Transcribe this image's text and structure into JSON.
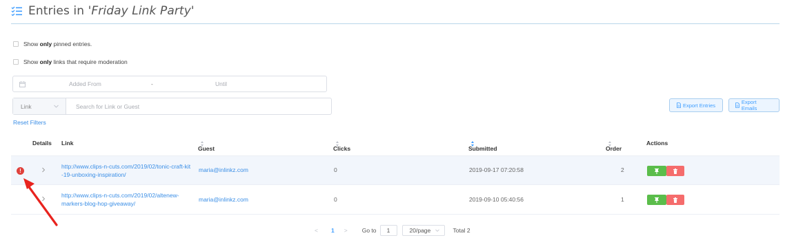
{
  "header": {
    "title_prefix": "Entries in ",
    "title_name": "'Friday Link Party'"
  },
  "filters": {
    "pinned_prefix": "Show ",
    "pinned_bold": "only",
    "pinned_suffix": " pinned entries.",
    "moderation_prefix": "Show ",
    "moderation_bold": "only",
    "moderation_suffix": " links that require moderation",
    "date_from_placeholder": "Added From",
    "date_separator": "-",
    "date_until_placeholder": "Until",
    "search_field": "Link",
    "search_placeholder": "Search for Link or Guest",
    "reset_label": "Reset Filters"
  },
  "export": {
    "entries_label": "Export Entries",
    "emails_label": "Export Emails"
  },
  "table": {
    "columns": {
      "details": "Details",
      "link": "Link",
      "guest": "Guest",
      "clicks": "Clicks",
      "submitted": "Submitted",
      "order": "Order",
      "actions": "Actions"
    },
    "rows": [
      {
        "link": "http://www.clips-n-cuts.com/2019/02/tonic-craft-kit-19-unboxing-inspiration/",
        "guest": "maria@inlinkz.com",
        "clicks": "0",
        "submitted": "2019-09-17 07:20:58",
        "order": "2",
        "warning": "!"
      },
      {
        "link": "http://www.clips-n-cuts.com/2019/02/altenew-markers-blog-hop-giveaway/",
        "guest": "maria@inlinkz.com",
        "clicks": "0",
        "submitted": "2019-09-10 05:40:56",
        "order": "1"
      }
    ]
  },
  "pagination": {
    "prev": "<",
    "current": "1",
    "next": ">",
    "goto_label": "Go to",
    "goto_value": "1",
    "page_size": "20/page",
    "total": "Total 2"
  },
  "colors": {
    "accent": "#409eff",
    "pin": "#5bbd4b",
    "delete": "#f56c6c",
    "warning": "#e0413c",
    "annotation_arrow": "#e8231e"
  }
}
